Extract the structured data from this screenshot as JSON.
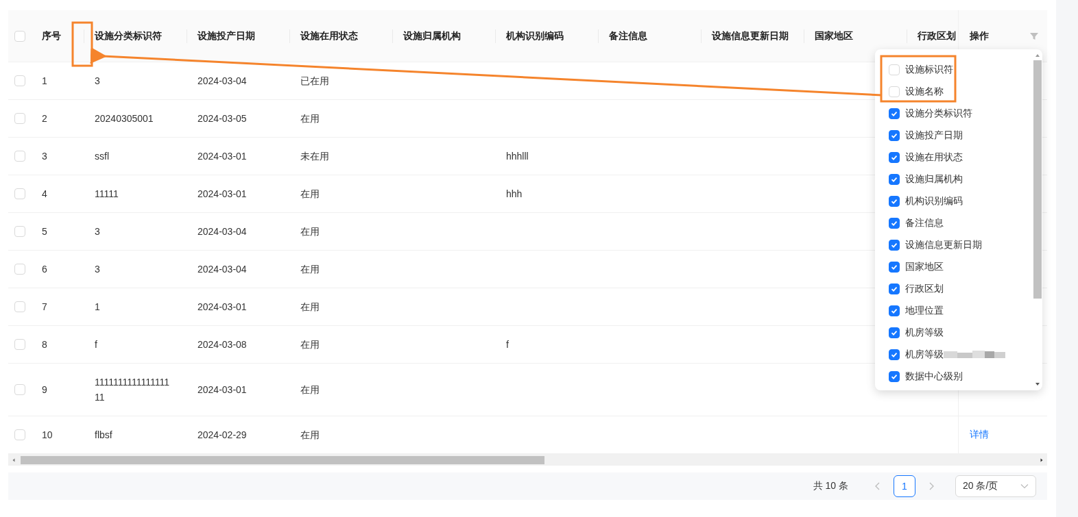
{
  "table": {
    "header_checkbox": {
      "checked": false
    },
    "index_column": "序号",
    "columns": [
      "设施分类标识符",
      "设施投产日期",
      "设施在用状态",
      "设施归属机构",
      "机构识别编码",
      "备注信息",
      "设施信息更新日期",
      "国家地区",
      "行政区划"
    ],
    "action_column": "操作",
    "rows": [
      {
        "checked": false,
        "index": "1",
        "category_id": "3",
        "commission_date": "2024-03-04",
        "status": "已在用"
      },
      {
        "checked": false,
        "index": "2",
        "category_id": "20240305001",
        "commission_date": "2024-03-05",
        "status": "在用"
      },
      {
        "checked": false,
        "index": "3",
        "category_id": "ssfl",
        "commission_date": "2024-03-01",
        "status": "未在用",
        "institution_code": "hhhlll"
      },
      {
        "checked": false,
        "index": "4",
        "category_id": "11111",
        "commission_date": "2024-03-01",
        "status": "在用",
        "institution_code": "hhh"
      },
      {
        "checked": false,
        "index": "5",
        "category_id": "3",
        "commission_date": "2024-03-04",
        "status": "在用"
      },
      {
        "checked": false,
        "index": "6",
        "category_id": "3",
        "commission_date": "2024-03-04",
        "status": "在用"
      },
      {
        "checked": false,
        "index": "7",
        "category_id": "1",
        "commission_date": "2024-03-01",
        "status": "在用"
      },
      {
        "checked": false,
        "index": "8",
        "category_id": "f",
        "commission_date": "2024-03-08",
        "status": "在用",
        "institution_code": "f"
      },
      {
        "checked": false,
        "index": "9",
        "category_id": "111111111111111111",
        "commission_date": "2024-03-01",
        "status": "在用"
      },
      {
        "checked": false,
        "index": "10",
        "category_id": "flbsf",
        "commission_date": "2024-02-29",
        "status": "在用",
        "action": "详情"
      }
    ]
  },
  "column_picker": {
    "items": [
      {
        "label": "设施标识符",
        "checked": false
      },
      {
        "label": "设施名称",
        "checked": false
      },
      {
        "label": "设施分类标识符",
        "checked": true
      },
      {
        "label": "设施投产日期",
        "checked": true
      },
      {
        "label": "设施在用状态",
        "checked": true
      },
      {
        "label": "设施归属机构",
        "checked": true
      },
      {
        "label": "机构识别编码",
        "checked": true
      },
      {
        "label": "备注信息",
        "checked": true
      },
      {
        "label": "设施信息更新日期",
        "checked": true
      },
      {
        "label": "国家地区",
        "checked": true
      },
      {
        "label": "行政区划",
        "checked": true
      },
      {
        "label": "地理位置",
        "checked": true
      },
      {
        "label": "机房等级",
        "checked": true
      },
      {
        "label": "机房等级",
        "checked": true,
        "redacted": true
      },
      {
        "label": "数据中心级别",
        "checked": true
      }
    ]
  },
  "pagination": {
    "total": "共 10 条",
    "pages": [
      {
        "label": "1",
        "selected": true
      }
    ],
    "page_size": "20 条/页"
  }
}
